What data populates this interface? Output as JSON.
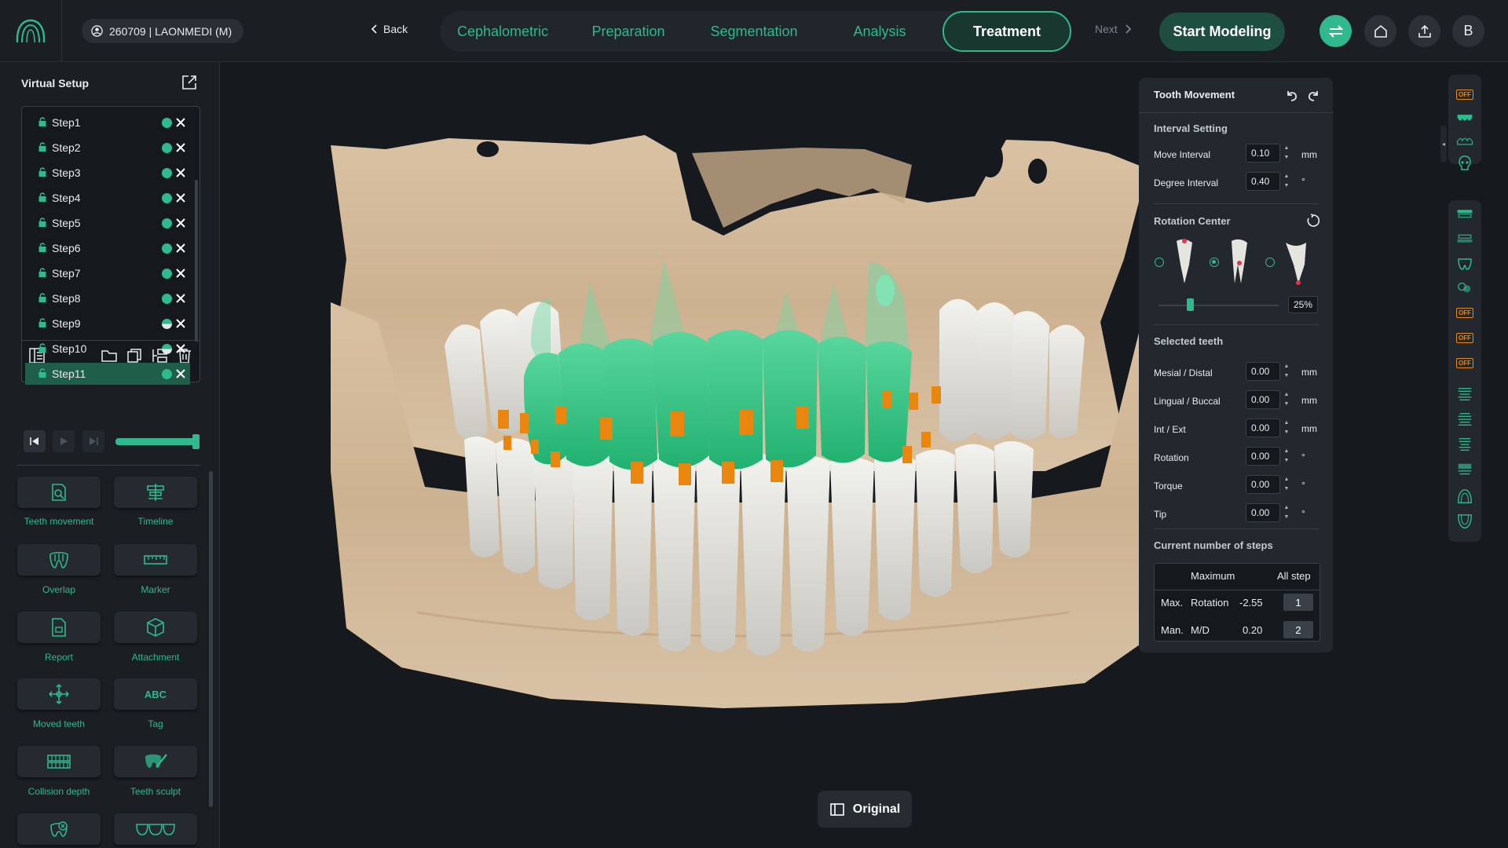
{
  "app": {
    "patient": "260709 | LAONMEDI (M)",
    "back_label": "Back",
    "next_label": "Next",
    "start_modeling_label": "Start Modeling",
    "user_initial": "B",
    "accent_color": "#2fb98c"
  },
  "nav": {
    "tabs": [
      {
        "label": "Cephalometric",
        "active": false
      },
      {
        "label": "Preparation",
        "active": false
      },
      {
        "label": "Segmentation",
        "active": false
      },
      {
        "label": "Analysis",
        "active": false
      },
      {
        "label": "Treatment",
        "active": true
      }
    ]
  },
  "header_icons": [
    "swap-icon",
    "home-icon",
    "upload-icon"
  ],
  "virtual_setup": {
    "title": "Virtual Setup",
    "selected_step": "Step11",
    "steps": [
      {
        "label": "Step1",
        "status": "full"
      },
      {
        "label": "Step2",
        "status": "full"
      },
      {
        "label": "Step3",
        "status": "full"
      },
      {
        "label": "Step4",
        "status": "full"
      },
      {
        "label": "Step5",
        "status": "full"
      },
      {
        "label": "Step6",
        "status": "full"
      },
      {
        "label": "Step7",
        "status": "full"
      },
      {
        "label": "Step8",
        "status": "full"
      },
      {
        "label": "Step9",
        "status": "half"
      },
      {
        "label": "Step10",
        "status": "half"
      },
      {
        "label": "Step11",
        "status": "full"
      }
    ],
    "playback_progress": 1.0
  },
  "tools": [
    {
      "label": "Teeth movement",
      "icon": "tooth-search-icon"
    },
    {
      "label": "Timeline",
      "icon": "timeline-icon"
    },
    {
      "label": "Overlap",
      "icon": "overlap-teeth-icon"
    },
    {
      "label": "Marker",
      "icon": "ruler-icon"
    },
    {
      "label": "Report",
      "icon": "report-icon"
    },
    {
      "label": "Attachment",
      "icon": "cube-icon"
    },
    {
      "label": "Moved teeth",
      "icon": "move-icon"
    },
    {
      "label": "Tag",
      "icon": "abc-tag-icon"
    },
    {
      "label": "Collision depth",
      "icon": "collision-icon"
    },
    {
      "label": "Teeth sculpt",
      "icon": "sculpt-icon"
    }
  ],
  "viewport": {
    "original_label": "Original"
  },
  "tooth_movement": {
    "title": "Tooth Movement",
    "interval_setting": "Interval Setting",
    "move_interval": {
      "label": "Move Interval",
      "value": "0.10",
      "unit": "mm"
    },
    "degree_interval": {
      "label": "Degree Interval",
      "value": "0.40",
      "unit": "°"
    },
    "rotation_center": "Rotation Center",
    "rotation_selected": 1,
    "rotation_percent": "25%",
    "rotation_slider_fraction": 0.25,
    "selected_teeth": "Selected teeth",
    "fields": [
      {
        "label": "Mesial / Distal",
        "value": "0.00",
        "unit": "mm"
      },
      {
        "label": "Lingual / Buccal",
        "value": "0.00",
        "unit": "mm"
      },
      {
        "label": "Int / Ext",
        "value": "0.00",
        "unit": "mm"
      },
      {
        "label": "Rotation",
        "value": "0.00",
        "unit": "°"
      },
      {
        "label": "Torque",
        "value": "0.00",
        "unit": "°"
      },
      {
        "label": "Tip",
        "value": "0.00",
        "unit": "°"
      }
    ],
    "current_steps": "Current number of steps",
    "table": {
      "col_maximum": "Maximum",
      "col_all_step": "All step",
      "rows": [
        {
          "label1": "Max.",
          "label2": "Rotation",
          "value": "-2.55",
          "step": "1"
        },
        {
          "label1": "Man.",
          "label2": "M/D",
          "value": "0.20",
          "step": "2"
        }
      ]
    }
  },
  "right_toolbar": {
    "off_label": "OFF"
  }
}
